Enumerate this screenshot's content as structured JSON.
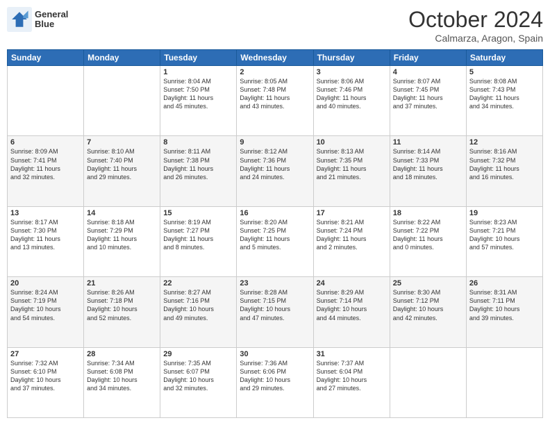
{
  "header": {
    "logo_line1": "General",
    "logo_line2": "Blue",
    "month": "October 2024",
    "location": "Calmarza, Aragon, Spain"
  },
  "weekdays": [
    "Sunday",
    "Monday",
    "Tuesday",
    "Wednesday",
    "Thursday",
    "Friday",
    "Saturday"
  ],
  "weeks": [
    [
      {
        "day": "",
        "detail": ""
      },
      {
        "day": "",
        "detail": ""
      },
      {
        "day": "1",
        "detail": "Sunrise: 8:04 AM\nSunset: 7:50 PM\nDaylight: 11 hours\nand 45 minutes."
      },
      {
        "day": "2",
        "detail": "Sunrise: 8:05 AM\nSunset: 7:48 PM\nDaylight: 11 hours\nand 43 minutes."
      },
      {
        "day": "3",
        "detail": "Sunrise: 8:06 AM\nSunset: 7:46 PM\nDaylight: 11 hours\nand 40 minutes."
      },
      {
        "day": "4",
        "detail": "Sunrise: 8:07 AM\nSunset: 7:45 PM\nDaylight: 11 hours\nand 37 minutes."
      },
      {
        "day": "5",
        "detail": "Sunrise: 8:08 AM\nSunset: 7:43 PM\nDaylight: 11 hours\nand 34 minutes."
      }
    ],
    [
      {
        "day": "6",
        "detail": "Sunrise: 8:09 AM\nSunset: 7:41 PM\nDaylight: 11 hours\nand 32 minutes."
      },
      {
        "day": "7",
        "detail": "Sunrise: 8:10 AM\nSunset: 7:40 PM\nDaylight: 11 hours\nand 29 minutes."
      },
      {
        "day": "8",
        "detail": "Sunrise: 8:11 AM\nSunset: 7:38 PM\nDaylight: 11 hours\nand 26 minutes."
      },
      {
        "day": "9",
        "detail": "Sunrise: 8:12 AM\nSunset: 7:36 PM\nDaylight: 11 hours\nand 24 minutes."
      },
      {
        "day": "10",
        "detail": "Sunrise: 8:13 AM\nSunset: 7:35 PM\nDaylight: 11 hours\nand 21 minutes."
      },
      {
        "day": "11",
        "detail": "Sunrise: 8:14 AM\nSunset: 7:33 PM\nDaylight: 11 hours\nand 18 minutes."
      },
      {
        "day": "12",
        "detail": "Sunrise: 8:16 AM\nSunset: 7:32 PM\nDaylight: 11 hours\nand 16 minutes."
      }
    ],
    [
      {
        "day": "13",
        "detail": "Sunrise: 8:17 AM\nSunset: 7:30 PM\nDaylight: 11 hours\nand 13 minutes."
      },
      {
        "day": "14",
        "detail": "Sunrise: 8:18 AM\nSunset: 7:29 PM\nDaylight: 11 hours\nand 10 minutes."
      },
      {
        "day": "15",
        "detail": "Sunrise: 8:19 AM\nSunset: 7:27 PM\nDaylight: 11 hours\nand 8 minutes."
      },
      {
        "day": "16",
        "detail": "Sunrise: 8:20 AM\nSunset: 7:25 PM\nDaylight: 11 hours\nand 5 minutes."
      },
      {
        "day": "17",
        "detail": "Sunrise: 8:21 AM\nSunset: 7:24 PM\nDaylight: 11 hours\nand 2 minutes."
      },
      {
        "day": "18",
        "detail": "Sunrise: 8:22 AM\nSunset: 7:22 PM\nDaylight: 11 hours\nand 0 minutes."
      },
      {
        "day": "19",
        "detail": "Sunrise: 8:23 AM\nSunset: 7:21 PM\nDaylight: 10 hours\nand 57 minutes."
      }
    ],
    [
      {
        "day": "20",
        "detail": "Sunrise: 8:24 AM\nSunset: 7:19 PM\nDaylight: 10 hours\nand 54 minutes."
      },
      {
        "day": "21",
        "detail": "Sunrise: 8:26 AM\nSunset: 7:18 PM\nDaylight: 10 hours\nand 52 minutes."
      },
      {
        "day": "22",
        "detail": "Sunrise: 8:27 AM\nSunset: 7:16 PM\nDaylight: 10 hours\nand 49 minutes."
      },
      {
        "day": "23",
        "detail": "Sunrise: 8:28 AM\nSunset: 7:15 PM\nDaylight: 10 hours\nand 47 minutes."
      },
      {
        "day": "24",
        "detail": "Sunrise: 8:29 AM\nSunset: 7:14 PM\nDaylight: 10 hours\nand 44 minutes."
      },
      {
        "day": "25",
        "detail": "Sunrise: 8:30 AM\nSunset: 7:12 PM\nDaylight: 10 hours\nand 42 minutes."
      },
      {
        "day": "26",
        "detail": "Sunrise: 8:31 AM\nSunset: 7:11 PM\nDaylight: 10 hours\nand 39 minutes."
      }
    ],
    [
      {
        "day": "27",
        "detail": "Sunrise: 7:32 AM\nSunset: 6:10 PM\nDaylight: 10 hours\nand 37 minutes."
      },
      {
        "day": "28",
        "detail": "Sunrise: 7:34 AM\nSunset: 6:08 PM\nDaylight: 10 hours\nand 34 minutes."
      },
      {
        "day": "29",
        "detail": "Sunrise: 7:35 AM\nSunset: 6:07 PM\nDaylight: 10 hours\nand 32 minutes."
      },
      {
        "day": "30",
        "detail": "Sunrise: 7:36 AM\nSunset: 6:06 PM\nDaylight: 10 hours\nand 29 minutes."
      },
      {
        "day": "31",
        "detail": "Sunrise: 7:37 AM\nSunset: 6:04 PM\nDaylight: 10 hours\nand 27 minutes."
      },
      {
        "day": "",
        "detail": ""
      },
      {
        "day": "",
        "detail": ""
      }
    ]
  ]
}
